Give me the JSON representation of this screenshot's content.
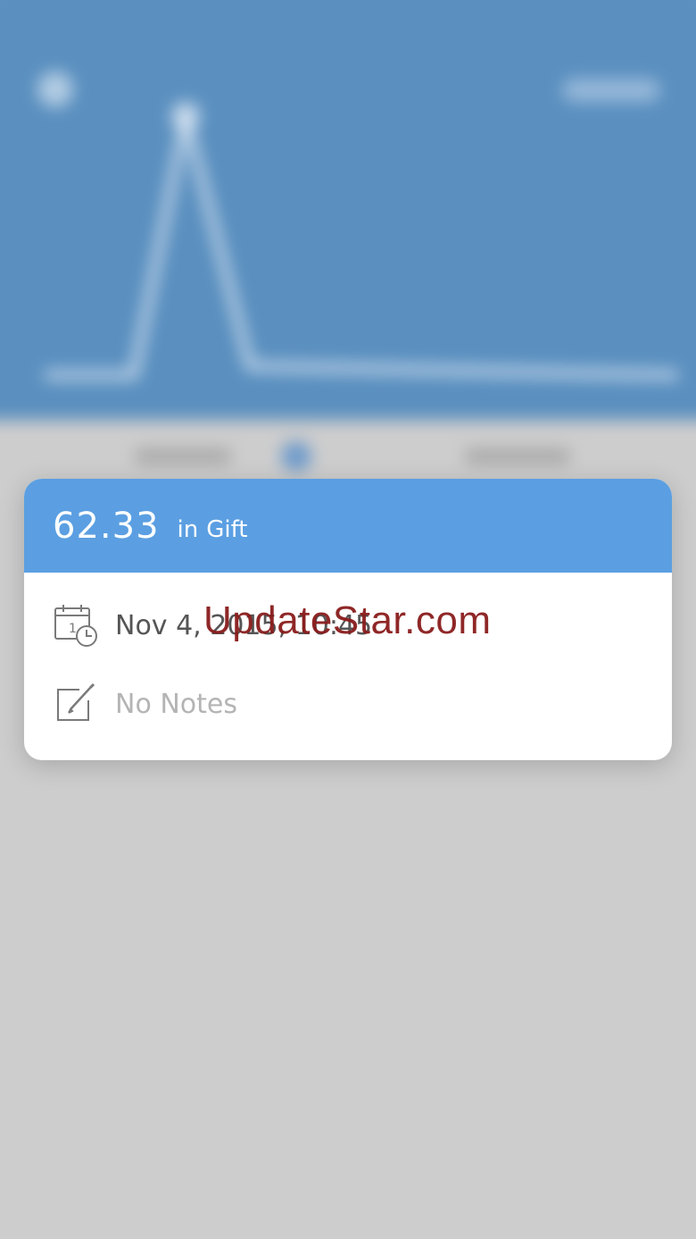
{
  "background": {
    "header_color": "#5a8fbf",
    "lower_color": "#cdcdcd"
  },
  "transaction_card": {
    "amount": "62.33",
    "category_prefix": "in",
    "category": "Gift",
    "date_time": "Nov 4, 2015, 10:45",
    "notes": "No Notes",
    "header_color": "#5b9fe2",
    "date_icon": "calendar-clock-icon",
    "notes_icon": "edit-note-icon"
  },
  "watermark": {
    "text": "UpdateStar.com",
    "color": "#8a1c1c"
  }
}
